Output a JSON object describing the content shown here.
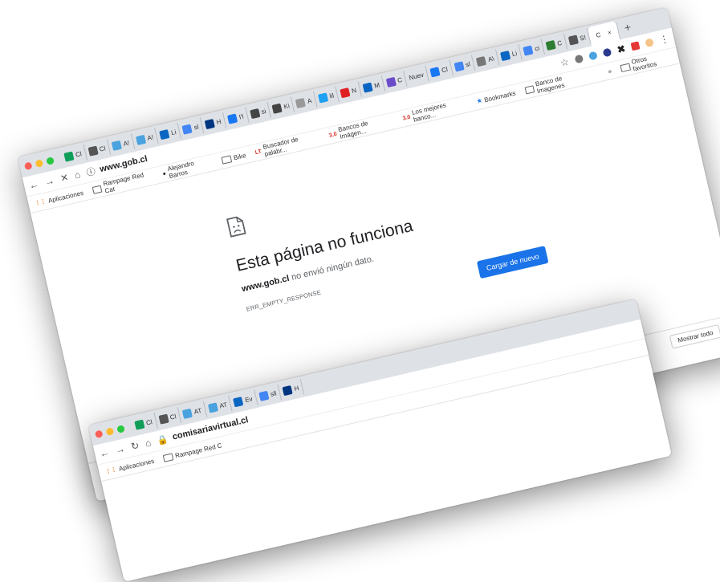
{
  "main_window": {
    "tabs": [
      {
        "label": "Cl",
        "icon": "sheets-icon",
        "color": "#0f9d58"
      },
      {
        "label": "Cl",
        "icon": "chrome-icon",
        "color": "#555555"
      },
      {
        "label": "A!",
        "icon": "blue-circle-icon",
        "color": "#4aa3df"
      },
      {
        "label": "A!",
        "icon": "blue-circle-icon",
        "color": "#4aa3df"
      },
      {
        "label": "Li",
        "icon": "linkedin-icon",
        "color": "#0a66c2"
      },
      {
        "label": "sl",
        "icon": "google-icon",
        "color": "#4285f4"
      },
      {
        "label": "H",
        "icon": "booking-icon",
        "color": "#003580"
      },
      {
        "label": "I'l",
        "icon": "facebook-icon",
        "color": "#1877f2"
      },
      {
        "label": "si",
        "icon": "web-icon",
        "color": "#444444"
      },
      {
        "label": "Ki",
        "icon": "web-icon",
        "color": "#444444"
      },
      {
        "label": "A",
        "icon": "spark-icon",
        "color": "#999999"
      },
      {
        "label": "lil",
        "icon": "twitter-icon",
        "color": "#1da1f2"
      },
      {
        "label": "N",
        "icon": "youtube-icon",
        "color": "#e02020"
      },
      {
        "label": "M",
        "icon": "linkedin-icon",
        "color": "#0a66c2"
      },
      {
        "label": "C",
        "icon": "purple-icon",
        "color": "#6a4cc9"
      },
      {
        "label": "Nuev",
        "icon": "none",
        "color": "#ffffff"
      },
      {
        "label": "Cl",
        "icon": "facebook-icon",
        "color": "#1877f2"
      },
      {
        "label": "sl",
        "icon": "google-icon",
        "color": "#4285f4"
      },
      {
        "label": "A\\",
        "icon": "wikipedia-icon",
        "color": "#777777"
      },
      {
        "label": "Li",
        "icon": "linkedin-icon",
        "color": "#0a66c2"
      },
      {
        "label": "ci",
        "icon": "google-icon",
        "color": "#4285f4"
      },
      {
        "label": "C",
        "icon": "green-icon",
        "color": "#2e7d32"
      },
      {
        "label": "S!",
        "icon": "chrome-icon",
        "color": "#555555"
      }
    ],
    "active_tab": {
      "label": "C",
      "close": "×"
    },
    "new_tab": "+",
    "url": "www.gob.cl",
    "bookmarks": [
      {
        "label": "Aplicaciones",
        "icon": "apps-grid-icon"
      },
      {
        "label": "Rampage Red Cat",
        "icon": "folder-icon"
      },
      {
        "label": "Alejandro Barros",
        "icon": "avatar-icon"
      },
      {
        "label": "Bike",
        "icon": "folder-icon"
      },
      {
        "label": "Buscador de palabr...",
        "icon": "lt-icon"
      },
      {
        "label": "Bancos de Imágen...",
        "icon": "three-zero-icon"
      },
      {
        "label": "Los mejores banco...",
        "icon": "three-zero-icon"
      },
      {
        "label": "Bookmarks",
        "icon": "star-icon"
      },
      {
        "label": "Banco de Imagenes",
        "icon": "folder-icon"
      }
    ],
    "other_bookmarks": "Otros favoritos",
    "error": {
      "title": "Esta página no funciona",
      "site": "www.gob.cl",
      "message": " no envió ningún dato.",
      "code": "ERR_EMPTY_RESPONSE",
      "reload_label": "Cargar de nuevo"
    },
    "download_bar": {
      "show_all": "Mostrar todo",
      "close": "×"
    }
  },
  "second_window": {
    "tabs": [
      {
        "label": "Cl",
        "icon": "sheets-icon",
        "color": "#0f9d58"
      },
      {
        "label": "Cl",
        "icon": "chrome-icon",
        "color": "#555555"
      },
      {
        "label": "AT",
        "icon": "blue-circle-icon",
        "color": "#4aa3df"
      },
      {
        "label": "AT",
        "icon": "blue-circle-icon",
        "color": "#4aa3df"
      },
      {
        "label": "Ev",
        "icon": "linkedin-icon",
        "color": "#0a66c2"
      },
      {
        "label": "sll",
        "icon": "google-icon",
        "color": "#4285f4"
      },
      {
        "label": "H",
        "icon": "booking-icon",
        "color": "#003580"
      }
    ],
    "url": "comisariavirtual.cl",
    "bookmarks": [
      {
        "label": "Aplicaciones",
        "icon": "apps-grid-icon"
      },
      {
        "label": "Rampage Red C",
        "icon": "folder-icon"
      }
    ]
  }
}
